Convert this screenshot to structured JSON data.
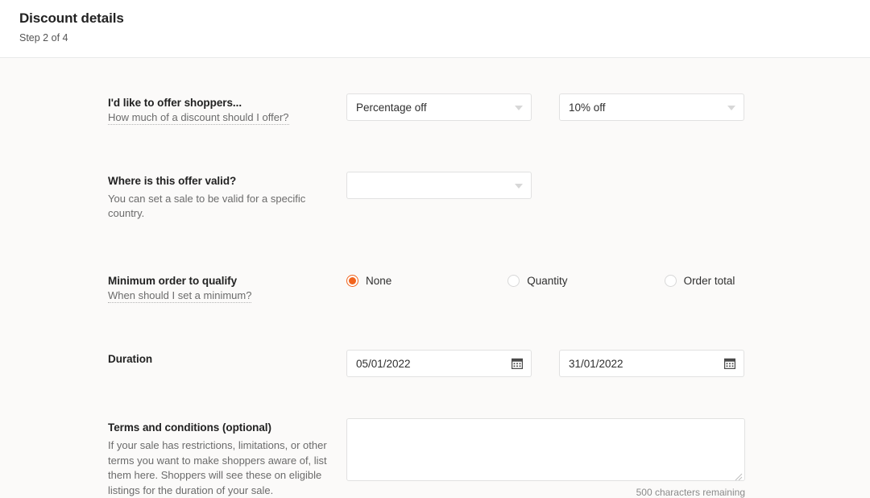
{
  "header": {
    "title": "Discount details",
    "step": "Step 2 of 4"
  },
  "colors": {
    "accent": "#f1641e",
    "page_background": "#fbfaf9",
    "header_background": "#ffffff",
    "field_border": "#e1e1e1",
    "help_text": "#6b6b6b"
  },
  "form": {
    "offer": {
      "label": "I'd like to offer shoppers...",
      "help": "How much of a discount should I offer?",
      "type_select": {
        "value": "Percentage off",
        "placeholder": "",
        "icon": "chevron-down-icon"
      },
      "amount_select": {
        "value": "10% off",
        "placeholder": "",
        "icon": "chevron-down-icon"
      }
    },
    "validity": {
      "label": "Where is this offer valid?",
      "help": "You can set a sale to be valid for a specific country.",
      "country_select": {
        "value": "",
        "placeholder": "",
        "icon": "chevron-down-icon"
      }
    },
    "minimum": {
      "label": "Minimum order to qualify",
      "help": "When should I set a minimum?",
      "options": [
        {
          "label": "None",
          "selected": true
        },
        {
          "label": "Quantity",
          "selected": false
        },
        {
          "label": "Order total",
          "selected": false
        }
      ]
    },
    "duration": {
      "label": "Duration",
      "start_date": {
        "value": "05/01/2022",
        "icon": "calendar-icon"
      },
      "end_date": {
        "value": "31/01/2022",
        "icon": "calendar-icon"
      }
    },
    "terms": {
      "label": "Terms and conditions (optional)",
      "help": "If your sale has restrictions, limitations, or other terms you want to make shoppers aware of, list them here. Shoppers will see these on eligible listings for the duration of your sale.",
      "textarea": {
        "value": "",
        "placeholder": ""
      },
      "char_count": "500 characters remaining"
    }
  }
}
